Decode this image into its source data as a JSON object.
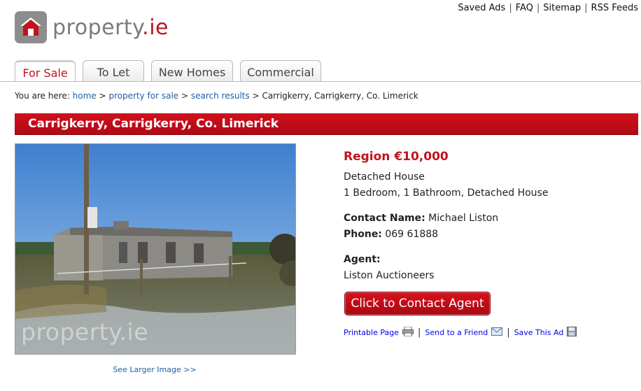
{
  "brand": {
    "name_main": "property",
    "name_dot": ".ie"
  },
  "toplinks": [
    "Saved Ads",
    "FAQ",
    "Sitemap",
    "RSS Feeds"
  ],
  "tabs": [
    {
      "label": "For Sale",
      "active": true
    },
    {
      "label": "To Let",
      "active": false
    },
    {
      "label": "New Homes",
      "active": false
    },
    {
      "label": "Commercial",
      "active": false
    }
  ],
  "breadcrumb": {
    "prefix": "You are here:",
    "links": [
      "home",
      "property for sale",
      "search results"
    ],
    "current": "Carrigkerry, Carrigkerry, Co. Limerick"
  },
  "listing": {
    "title": "Carrigkerry, Carrigkerry, Co. Limerick",
    "price": "Region €10,000",
    "type": "Detached House",
    "summary": "1 Bedroom, 1 Bathroom, Detached House",
    "contact_label": "Contact Name:",
    "contact_name": "Michael Liston",
    "phone_label": "Phone:",
    "phone": "069 61888",
    "agent_label": "Agent:",
    "agent": "Liston Auctioneers"
  },
  "photo": {
    "watermark": "property.ie",
    "larger_link": "See Larger Image >>"
  },
  "buttons": {
    "contact_agent": "Click to Contact Agent"
  },
  "actions": {
    "print": "Printable Page",
    "send": "Send to a Friend",
    "save": "Save This Ad"
  },
  "colors": {
    "brand_red": "#c2121f",
    "link_blue": "#1f5fa6"
  }
}
